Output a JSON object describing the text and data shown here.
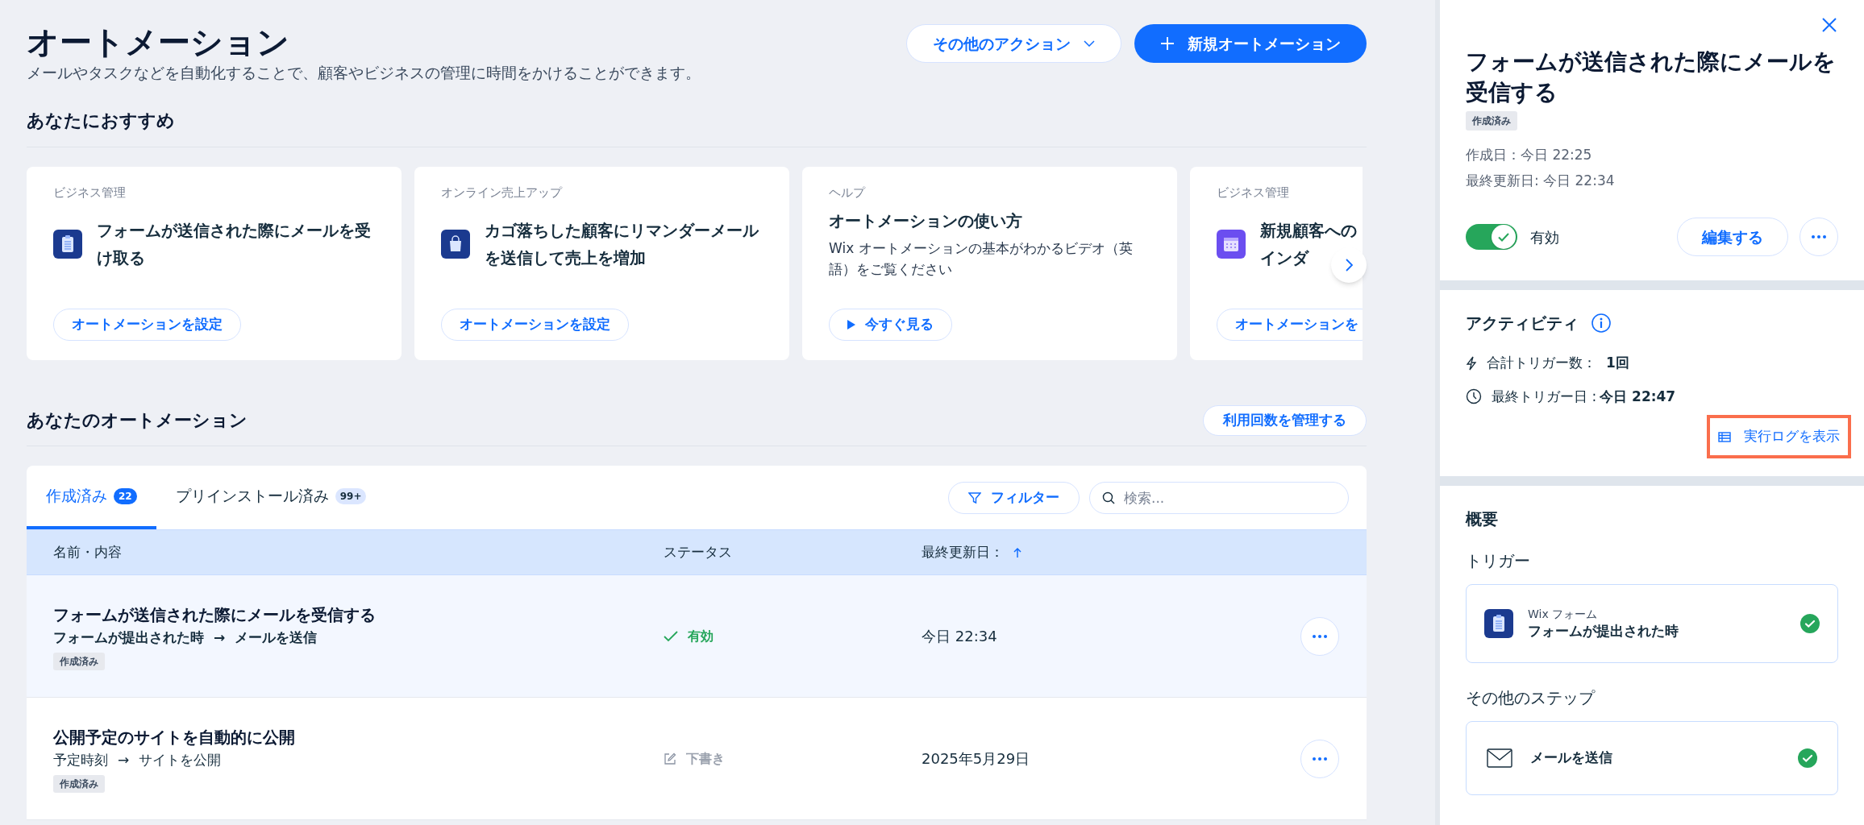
{
  "header": {
    "title": "オートメーション",
    "subtitle": "メールやタスクなどを自動化することで、顧客やビジネスの管理に時間をかけることができます。",
    "more_actions": "その他のアクション",
    "new_button": "新規オートメーション"
  },
  "recommended": {
    "heading": "あなたにおすすめ",
    "cards": [
      {
        "kind": "form",
        "category": "ビジネス管理",
        "title": "フォームが送信された際にメールを受け取る",
        "button": "オートメーションを設定"
      },
      {
        "kind": "cart",
        "category": "オンライン売上アップ",
        "title": "カゴ落ちした顧客にリマンダーメールを送信して売上を増加",
        "button": "オートメーションを設定"
      },
      {
        "kind": "video",
        "category": "ヘルプ",
        "title": "オートメーションの使い方",
        "description": "Wix オートメーションの基本がわかるビデオ（英語）をご覧ください",
        "button": "今すぐ見る"
      },
      {
        "kind": "calendar",
        "category": "ビジネス管理",
        "title_lines": [
          "新規顧客への",
          "インダ"
        ],
        "button": "オートメーションを"
      }
    ]
  },
  "automations": {
    "heading": "あなたのオートメーション",
    "manage_button": "利用回数を管理する",
    "tabs": [
      {
        "label": "作成済み",
        "count": "22",
        "selected": true
      },
      {
        "label": "プリインストール済み",
        "count": "99+",
        "selected": false
      }
    ],
    "filter_button": "フィルター",
    "search": {
      "placeholder": "検索..."
    },
    "columns": [
      "名前・内容",
      "ステータス",
      "最終更新日："
    ],
    "rows": [
      {
        "title": "フォームが送信された際にメールを受信する",
        "trigger": "フォームが提出された時",
        "arrow": "→",
        "action": "メールを送信",
        "tag": "作成済み",
        "status": "有効",
        "kind": "active",
        "updated": "今日 22:34",
        "selected": true
      },
      {
        "title": "公開予定のサイトを自動的に公開",
        "trigger": "予定時刻",
        "arrow": "→",
        "action": "サイトを公開",
        "tag": "作成済み",
        "status": "下書き",
        "kind": "draft",
        "updated": "2025年5月29日",
        "selected": false
      }
    ]
  },
  "panel": {
    "title": "フォームが送信された際にメールを受信する",
    "tag": "作成済み",
    "created": "作成日：今日 22:25",
    "updated": "最終更新日: 今日 22:34",
    "toggle": {
      "on": true,
      "label": "有効"
    },
    "edit_button": "編集する",
    "activity": {
      "heading": "アクティビティ",
      "total_label": "合計トリガー数：",
      "total_value": "1回",
      "last_label": "最終トリガー日 : ",
      "last_value": "今日 22:47",
      "log_link": "実行ログを表示",
      "highlighted": true
    },
    "overview": {
      "heading": "概要",
      "trigger_heading": "トリガー",
      "trigger": {
        "app": "Wix フォーム",
        "label": "フォームが提出された時",
        "done": true
      },
      "steps_heading": "その他のステップ",
      "steps": [
        {
          "label": "メールを送信",
          "done": true
        }
      ]
    }
  }
}
